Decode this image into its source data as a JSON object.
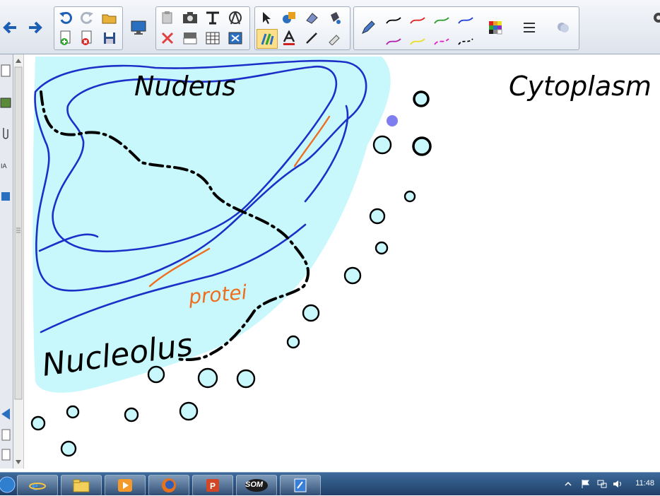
{
  "toolbar": {
    "buttons": [
      {
        "name": "back-button",
        "icon": "arrow-left-icon"
      },
      {
        "name": "forward-button",
        "icon": "arrow-right-icon"
      },
      {
        "name": "undo-button",
        "icon": "undo-icon"
      },
      {
        "name": "redo-button",
        "icon": "redo-icon"
      },
      {
        "name": "open-button",
        "icon": "folder-open-icon"
      },
      {
        "name": "add-page-button",
        "icon": "add-page-icon"
      },
      {
        "name": "delete-page-button",
        "icon": "delete-page-icon"
      },
      {
        "name": "save-button",
        "icon": "save-icon"
      },
      {
        "name": "display-button",
        "icon": "monitor-icon"
      },
      {
        "name": "paste-button",
        "icon": "paste-icon"
      },
      {
        "name": "delete-button",
        "icon": "delete-x-icon"
      },
      {
        "name": "screenshot-button",
        "icon": "camera-icon"
      },
      {
        "name": "screen-shade-button",
        "icon": "screen-shade-icon"
      },
      {
        "name": "text-tool-button",
        "icon": "text-format-icon"
      },
      {
        "name": "table-button",
        "icon": "table-icon"
      },
      {
        "name": "measure-button",
        "icon": "measure-icon"
      },
      {
        "name": "fullscreen-button",
        "icon": "fullscreen-icon"
      },
      {
        "name": "select-tool",
        "icon": "pointer-icon"
      },
      {
        "name": "pens-tool",
        "icon": "pens-icon"
      },
      {
        "name": "shapes-tool",
        "icon": "shapes-icon"
      },
      {
        "name": "text-tool",
        "icon": "text-a-icon"
      },
      {
        "name": "eraser-tool",
        "icon": "eraser-icon"
      },
      {
        "name": "line-tool",
        "icon": "line-icon"
      },
      {
        "name": "fill-tool",
        "icon": "fill-icon"
      },
      {
        "name": "magic-pen-tool",
        "icon": "magic-pen-icon"
      }
    ],
    "pen_colors": [
      "#000000",
      "#e02020",
      "#2e9a2e",
      "#1f3cd8",
      "#b020b0",
      "#e8e020",
      "#e020c8",
      "#000000"
    ],
    "accent": "#1f3cd8"
  },
  "drawing": {
    "labels": {
      "nucleus_region": "Nudeus",
      "nucleolus": "Nucleolus",
      "protein": "protei",
      "cytoplasm": "Cytoplasm"
    },
    "colors": {
      "nucleus_fill": "#c8f8fc",
      "chromatin": "#1c2fc8",
      "protein": "#ef6e1e",
      "ink": "#000000",
      "ribosome_fill": "#c8f8fc",
      "highlight_dot": "#7e7ef0"
    }
  },
  "taskbar": {
    "apps": [
      {
        "name": "internet-explorer",
        "icon": "ie-icon"
      },
      {
        "name": "file-explorer",
        "icon": "folder-icon"
      },
      {
        "name": "media-player",
        "icon": "media-play-icon"
      },
      {
        "name": "firefox",
        "icon": "firefox-icon"
      },
      {
        "name": "powerpoint",
        "icon": "powerpoint-icon"
      },
      {
        "name": "som",
        "label": "SOM",
        "icon": "som-icon"
      },
      {
        "name": "notebook",
        "icon": "notebook-icon"
      }
    ],
    "clock": "11:48"
  }
}
